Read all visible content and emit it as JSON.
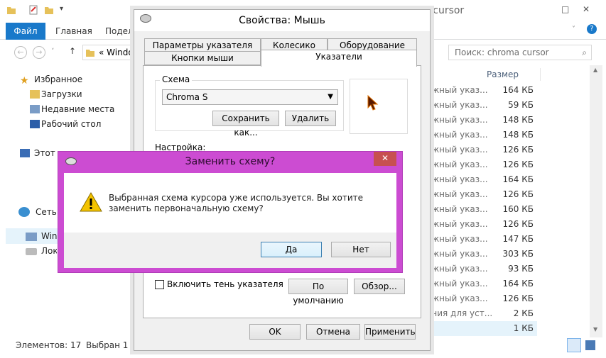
{
  "explorer": {
    "title": "chroma cursor",
    "ribbon_tabs": [
      "Файл",
      "Главная",
      "Поделиться"
    ],
    "address": "« Windo",
    "search_placeholder": "Поиск: chroma cursor",
    "nav": {
      "favorites": "Избранное",
      "downloads": "Загрузки",
      "recent": "Недавние места",
      "desktop": "Рабочий стол",
      "this_pc": "Этот компьютер",
      "windows": "Windows",
      "local": "Локальный диск",
      "network": "Сеть"
    },
    "size_header": "Размер",
    "rows": [
      {
        "name": "ожный указ...",
        "size": "164 КБ"
      },
      {
        "name": "ожный указ...",
        "size": "59 КБ"
      },
      {
        "name": "ожный указ...",
        "size": "148 КБ"
      },
      {
        "name": "ожный указ...",
        "size": "148 КБ"
      },
      {
        "name": "ожный указ...",
        "size": "126 КБ"
      },
      {
        "name": "ожный указ...",
        "size": "126 КБ"
      },
      {
        "name": "ожный указ...",
        "size": "164 КБ"
      },
      {
        "name": "ожный указ...",
        "size": "126 КБ"
      },
      {
        "name": "ожный указ...",
        "size": "160 КБ"
      },
      {
        "name": "ожный указ...",
        "size": "126 КБ"
      },
      {
        "name": "ожный указ...",
        "size": "147 КБ"
      },
      {
        "name": "ожный указ...",
        "size": "303 КБ"
      },
      {
        "name": "ожный указ...",
        "size": "93 КБ"
      },
      {
        "name": "ожный указ...",
        "size": "164 КБ"
      },
      {
        "name": "ожный указ...",
        "size": "126 КБ"
      },
      {
        "name": "ения для уст...",
        "size": "2 КБ"
      },
      {
        "name": "",
        "size": "1 КБ"
      }
    ],
    "status_items": "Элементов: 17",
    "status_selected": "Выбран 1 эл"
  },
  "mouse_props": {
    "title": "Свойства: Мышь",
    "tabs_back": [
      "Параметры указателя",
      "Колесико",
      "Оборудование"
    ],
    "tabs_front": [
      "Кнопки мыши",
      "Указатели"
    ],
    "scheme_label": "Схема",
    "scheme_value": "Chroma S",
    "save_as": "Сохранить как...",
    "delete": "Удалить",
    "customize_label": "Настройка:",
    "shadow_label": "Включить тень указателя",
    "default_btn": "По умолчанию",
    "browse_btn": "Обзор...",
    "ok": "OK",
    "cancel": "Отмена",
    "apply": "Применить"
  },
  "confirm": {
    "title": "Заменить схему?",
    "message": "Выбранная схема курсора уже используется.  Вы хотите заменить первоначальную схему?",
    "yes": "Да",
    "no": "Нет"
  },
  "colors": {
    "accent": "#1979ca",
    "dialog_frame": "#cc4cd2",
    "close": "#c75050"
  }
}
